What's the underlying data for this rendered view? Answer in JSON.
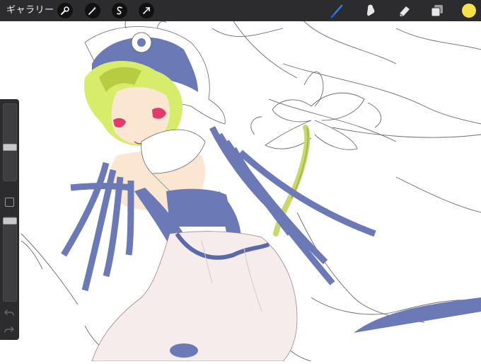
{
  "topbar": {
    "gallery_label": "ギャラリー",
    "left_tools": [
      "wrench-icon",
      "magic-wand-icon",
      "selection-icon",
      "transform-icon"
    ],
    "right_tools": [
      "brush-icon",
      "smudge-icon",
      "eraser-icon",
      "layers-icon"
    ],
    "active_tool": "brush-icon",
    "current_color": "#f7e14a",
    "accent": "#2f7cf6"
  },
  "sidebar": {
    "brush_size_level": 0.57,
    "brush_opacity_level": 0.0
  }
}
